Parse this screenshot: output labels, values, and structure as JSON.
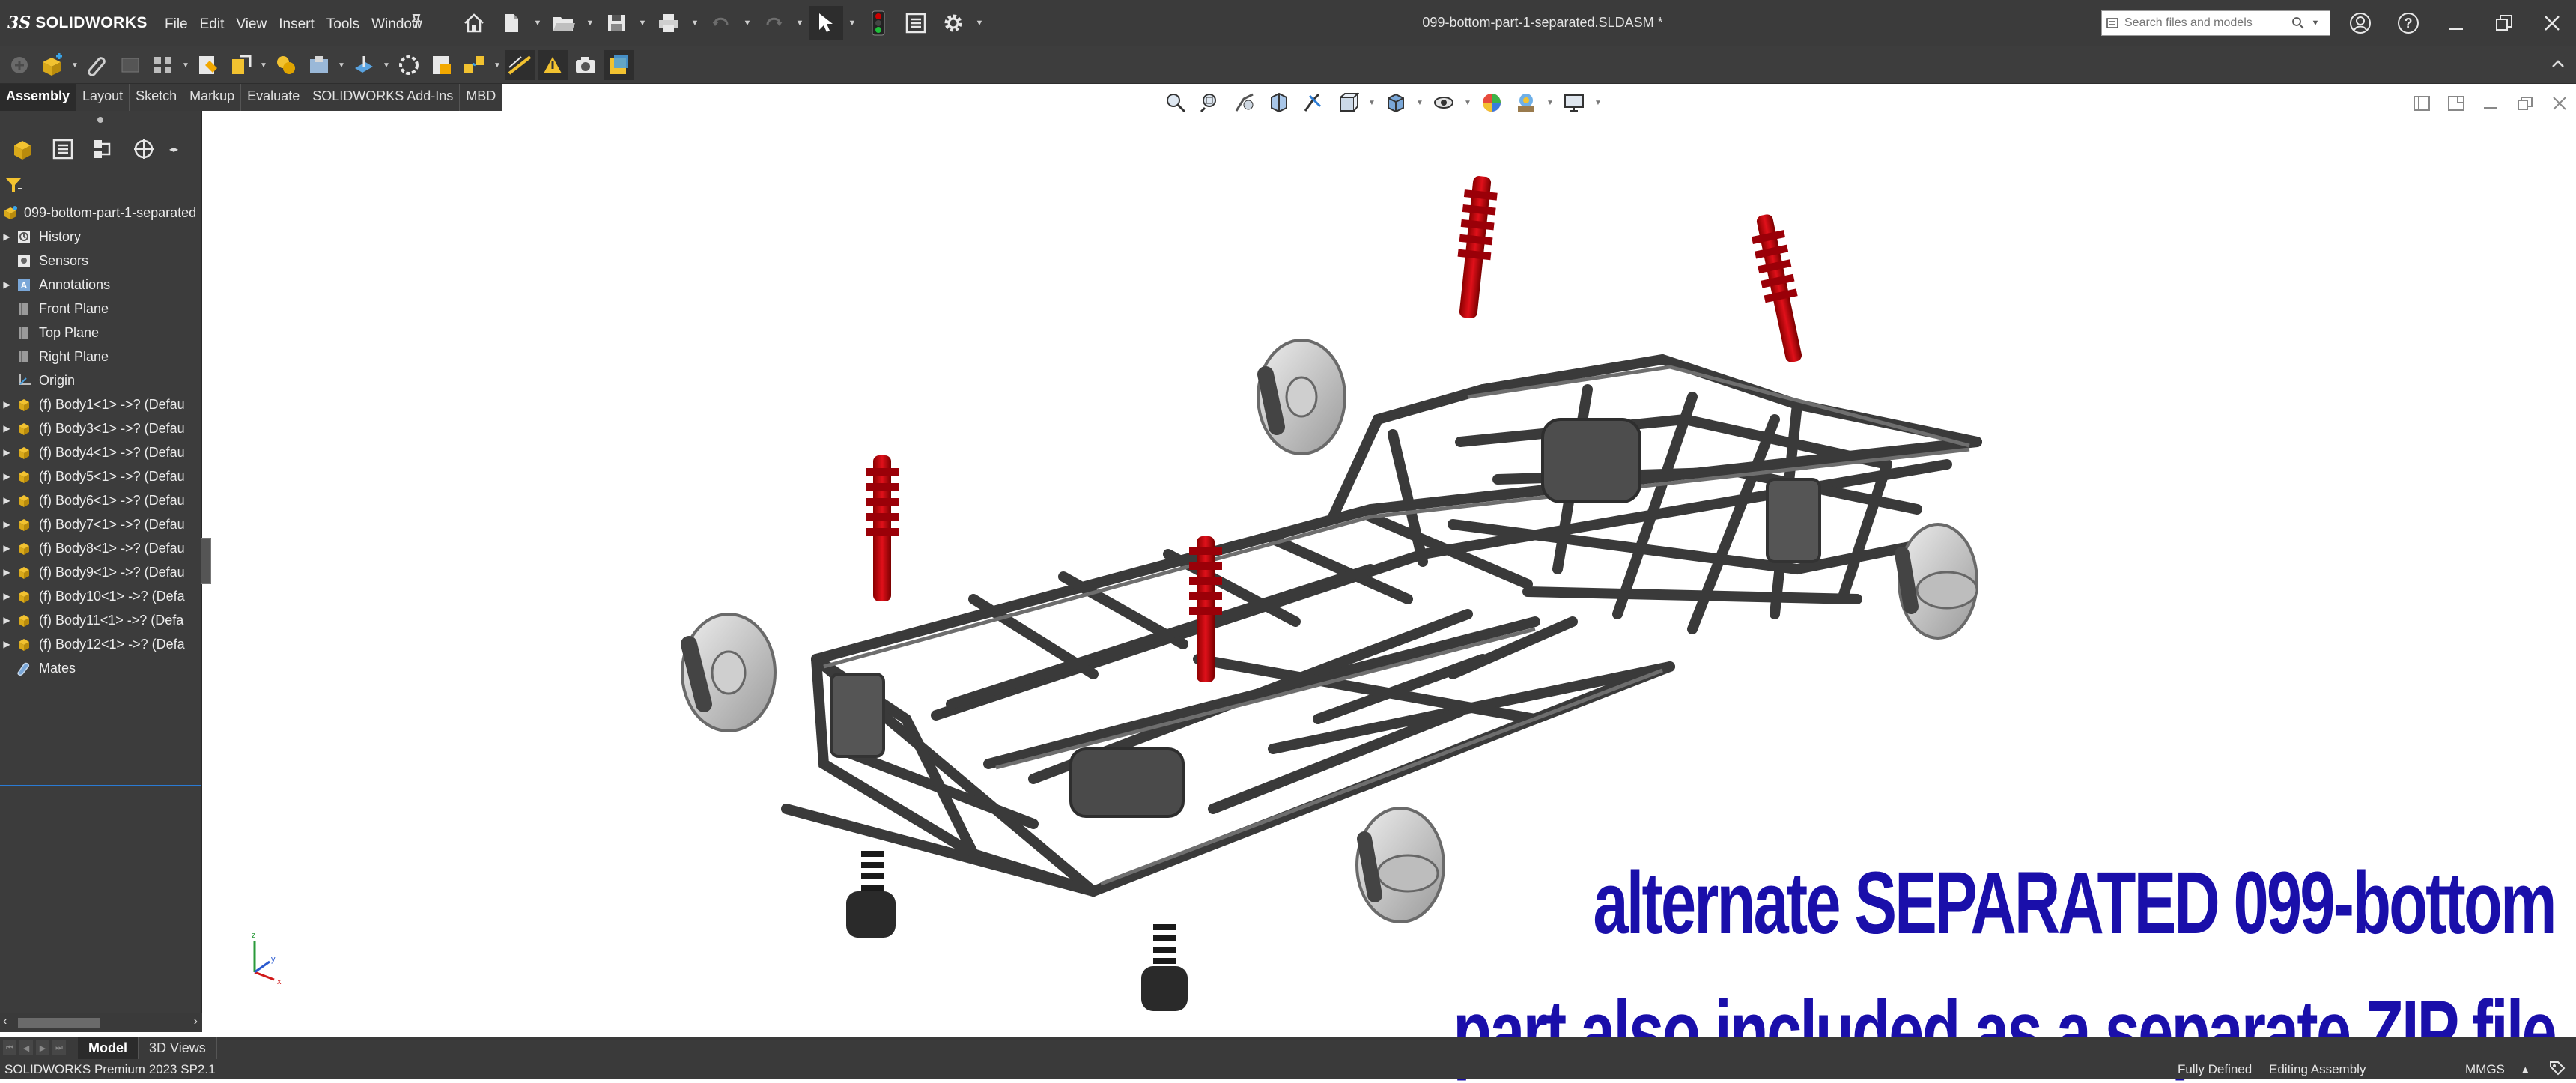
{
  "app": {
    "logo_prefix": "3S",
    "logo_name": "SOLIDWORKS",
    "document_title": "099-bottom-part-1-separated.SLDASM *"
  },
  "menu": [
    "File",
    "Edit",
    "View",
    "Insert",
    "Tools",
    "Window"
  ],
  "search": {
    "placeholder": "Search files and models"
  },
  "command_tabs": [
    {
      "label": "Assembly",
      "active": true
    },
    {
      "label": "Layout"
    },
    {
      "label": "Sketch"
    },
    {
      "label": "Markup"
    },
    {
      "label": "Evaluate"
    },
    {
      "label": "SOLIDWORKS Add-Ins"
    },
    {
      "label": "MBD"
    }
  ],
  "tree": {
    "root": "099-bottom-part-1-separated",
    "items": [
      {
        "label": "History",
        "icon": "history-icon",
        "expandable": true
      },
      {
        "label": "Sensors",
        "icon": "sensor-icon",
        "expandable": false
      },
      {
        "label": "Annotations",
        "icon": "annotations-icon",
        "expandable": true
      },
      {
        "label": "Front Plane",
        "icon": "plane-icon",
        "expandable": false
      },
      {
        "label": "Top Plane",
        "icon": "plane-icon",
        "expandable": false
      },
      {
        "label": "Right Plane",
        "icon": "plane-icon",
        "expandable": false
      },
      {
        "label": "Origin",
        "icon": "origin-icon",
        "expandable": false
      },
      {
        "label": "(f) Body1<1> ->? (Defau",
        "icon": "part-icon",
        "expandable": true
      },
      {
        "label": "(f) Body3<1> ->? (Defau",
        "icon": "part-icon",
        "expandable": true
      },
      {
        "label": "(f) Body4<1> ->? (Defau",
        "icon": "part-icon",
        "expandable": true
      },
      {
        "label": "(f) Body5<1> ->? (Defau",
        "icon": "part-icon",
        "expandable": true
      },
      {
        "label": "(f) Body6<1> ->? (Defau",
        "icon": "part-icon",
        "expandable": true
      },
      {
        "label": "(f) Body7<1> ->? (Defau",
        "icon": "part-icon",
        "expandable": true
      },
      {
        "label": "(f) Body8<1> ->? (Defau",
        "icon": "part-icon",
        "expandable": true
      },
      {
        "label": "(f) Body9<1> ->? (Defau",
        "icon": "part-icon",
        "expandable": true
      },
      {
        "label": "(f) Body10<1> ->? (Defa",
        "icon": "part-icon",
        "expandable": true
      },
      {
        "label": "(f) Body11<1> ->? (Defa",
        "icon": "part-icon",
        "expandable": true
      },
      {
        "label": "(f) Body12<1> ->? (Defa",
        "icon": "part-icon",
        "expandable": true
      },
      {
        "label": "Mates",
        "icon": "mates-icon",
        "expandable": false
      }
    ]
  },
  "model_tabs": [
    {
      "label": "Model",
      "active": true
    },
    {
      "label": "3D Views"
    }
  ],
  "status": {
    "version": "SOLIDWORKS Premium 2023 SP2.1",
    "definition": "Fully Defined",
    "mode": "Editing Assembly",
    "units": "MMGS"
  },
  "overlay_text": {
    "line1": "alternate SEPARATED 099-bottom",
    "line2": "part also included as a separate ZIP file"
  },
  "colors": {
    "overlay_text": "#1a0faa",
    "shock_red": "#c00010",
    "frame_gray": "#5a5a5a",
    "ui_dark": "#3b3b3b",
    "selection_blue": "#2a7bd4"
  }
}
